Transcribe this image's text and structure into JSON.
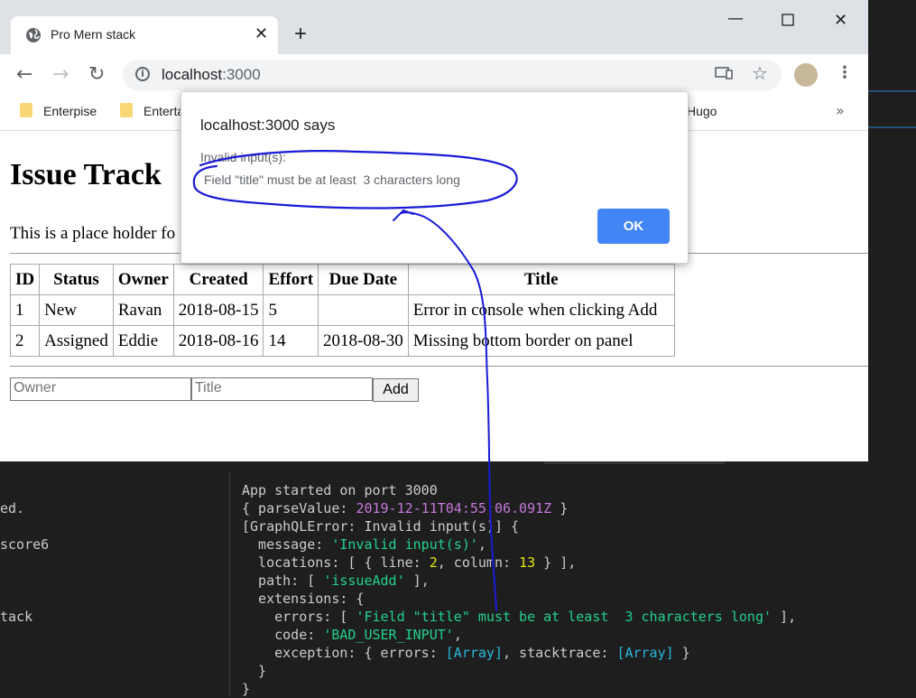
{
  "browser": {
    "tab_title": "Pro Mern stack",
    "new_tab": "+",
    "url_host": "localhost",
    "url_port": ":3000",
    "bookmarks": [
      "Enterpise",
      "Enterta",
      "Hugo"
    ],
    "bookmarks_more": "»"
  },
  "page": {
    "heading": "Issue Track",
    "placeholder_text": "This is a place holder fo",
    "table": {
      "headers": [
        "ID",
        "Status",
        "Owner",
        "Created",
        "Effort",
        "Due Date",
        "Title"
      ],
      "rows": [
        [
          "1",
          "New",
          "Ravan",
          "2018-08-15",
          "5",
          "",
          "Error in console when clicking Add"
        ],
        [
          "2",
          "Assigned",
          "Eddie",
          "2018-08-16",
          "14",
          "2018-08-30",
          "Missing bottom border on panel"
        ]
      ]
    },
    "form": {
      "owner_placeholder": "Owner",
      "title_placeholder": "Title",
      "add_label": "Add"
    }
  },
  "dialog": {
    "title": "localhost:3000 says",
    "line1": "Invalid input(s):",
    "line2": "Field \"title\" must be at least  3 characters long",
    "ok_label": "OK"
  },
  "terminal": {
    "left_lines": [
      "ed.",
      "score6",
      "tack"
    ],
    "close": "✕",
    "lines": {
      "l1": "App started on port 3000",
      "l2a": "{ parseValue: ",
      "l2b": "2019-12-11T04:55:06.091Z",
      "l2c": " }",
      "l3": "[GraphQLError: Invalid input(s)] {",
      "l4a": "  message: ",
      "l4b": "'Invalid input(s)'",
      "l4c": ",",
      "l5a": "  locations: [ { line: ",
      "l5b": "2",
      "l5c": ", column: ",
      "l5d": "13",
      "l5e": " } ],",
      "l6a": "  path: [ ",
      "l6b": "'issueAdd'",
      "l6c": " ],",
      "l7": "  extensions: {",
      "l8a": "    errors: [ ",
      "l8b": "'Field \"title\" must be at least  3 characters long'",
      "l8c": " ],",
      "l9a": "    code: ",
      "l9b": "'BAD_USER_INPUT'",
      "l9c": ",",
      "l10a": "    exception: { errors: ",
      "l10b": "[Array]",
      "l10c": ", stacktrace: ",
      "l10d": "[Array]",
      "l10e": " }",
      "l11": "  }",
      "l12": "}"
    }
  },
  "colors": {
    "ok_button": "#4285f4",
    "ink": "#1a1ad6"
  }
}
